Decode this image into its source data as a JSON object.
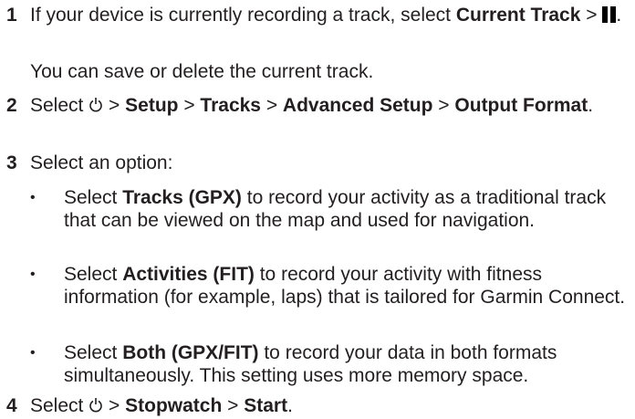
{
  "steps": [
    {
      "number": "1",
      "pre": "If your device is currently recording a track, select ",
      "bold1": "Current Track",
      "sep": " > ",
      "icon": "pause-icon",
      "post": ".",
      "note": "You can save or delete the current track."
    },
    {
      "number": "2",
      "pre": "Select ",
      "icon": "power-icon",
      "sep1": " > ",
      "bold1": "Setup",
      "sep2": " > ",
      "bold2": "Tracks",
      "sep3": " > ",
      "bold3": "Advanced Setup",
      "sep4": " > ",
      "bold4": "Output Format",
      "post": "."
    },
    {
      "number": "3",
      "text": "Select an option:",
      "bullets": [
        {
          "pre": "Select ",
          "bold": "Tracks (GPX)",
          "post": " to record your activity as a traditional track that can be viewed on the map and used for navigation."
        },
        {
          "pre": "Select ",
          "bold": "Activities (FIT)",
          "post": " to record your activity with fitness information (for example, laps) that is tailored for Garmin Connect."
        },
        {
          "pre": "Select ",
          "bold": "Both (GPX/FIT)",
          "post": " to record your data in both formats simultaneously. This setting uses more memory space."
        }
      ]
    },
    {
      "number": "4",
      "pre": "Select ",
      "icon": "power-icon",
      "sep1": " > ",
      "bold1": "Stopwatch",
      "sep2": " > ",
      "bold2": "Start",
      "post": "."
    }
  ],
  "bullet_glyph": "•"
}
